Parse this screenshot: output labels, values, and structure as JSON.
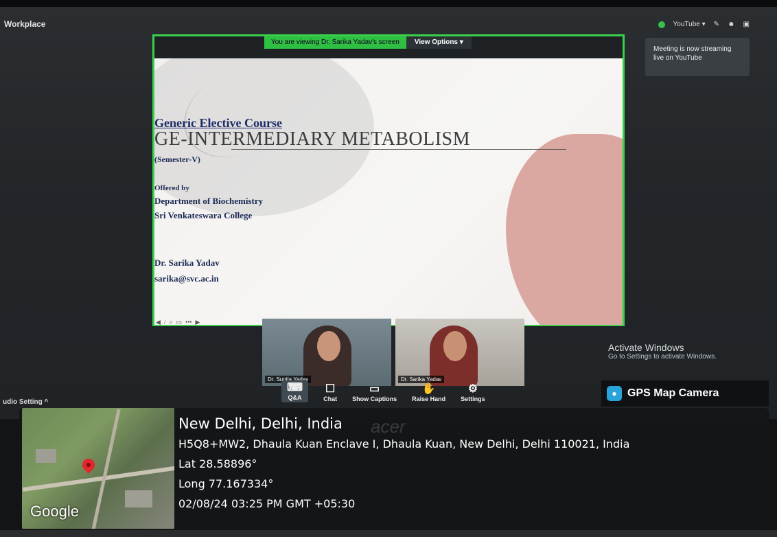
{
  "app": {
    "workplace_label": "Workplace"
  },
  "top_bar": {
    "youtube_label": "YouTube ▾"
  },
  "streaming_notice": "Meeting is now streaming live on YouTube",
  "share": {
    "viewing_text": "You are viewing  Dr. Sarika Yadav's screen",
    "view_options_label": "View Options ▾"
  },
  "slide": {
    "course": "Generic Elective Course",
    "title": "GE-INTERMEDIARY METABOLISM",
    "semester": "(Semester-V)",
    "offered": "Offered by",
    "department": "Department of Biochemistry",
    "college": "Sri Venkateswara College",
    "presenter": "Dr. Sarika Yadav",
    "email": "sarika@svc.ac.in"
  },
  "participants": [
    {
      "name": "Dr. Sunita Yadav"
    },
    {
      "name": "Dr. Sarika Yadav"
    }
  ],
  "toolbar": {
    "qa": "Q&A",
    "chat": "Chat",
    "captions": "Show Captions",
    "raise_hand": "Raise Hand",
    "settings": "Settings"
  },
  "audio_setting": "udio Setting ^",
  "activate_windows": {
    "title": "Activate Windows",
    "subtitle": "Go to Settings to activate Windows."
  },
  "gps": {
    "app_name": "GPS Map Camera",
    "city": "New Delhi, Delhi, India",
    "address": "H5Q8+MW2, Dhaula Kuan Enclave I, Dhaula Kuan, New Delhi, Delhi 110021, India",
    "lat": "Lat 28.58896°",
    "long": "Long 77.167334°",
    "datetime": "02/08/24 03:25 PM GMT +05:30",
    "map_brand": "Google"
  },
  "monitor_brand": "acer"
}
